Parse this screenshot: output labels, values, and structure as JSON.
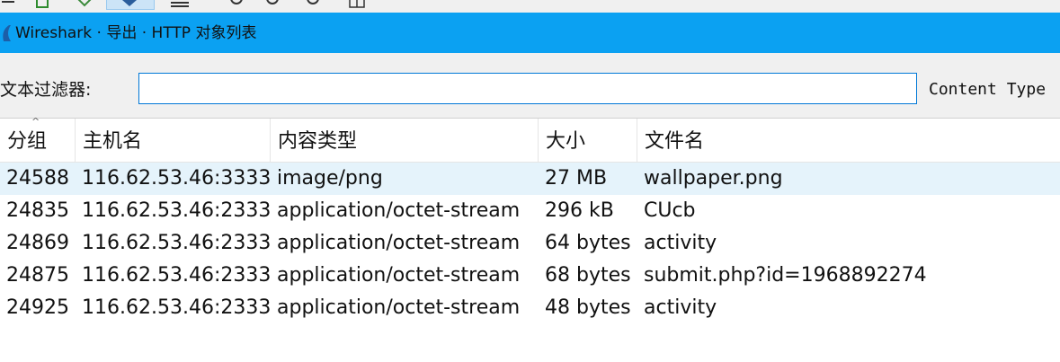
{
  "window": {
    "title": "Wireshark · 导出 · HTTP 对象列表"
  },
  "filter": {
    "label": "文本过滤器:",
    "value": "",
    "content_type_label": "Content Type"
  },
  "table": {
    "columns": [
      "分组",
      "主机名",
      "内容类型",
      "大小",
      "文件名"
    ],
    "rows": [
      {
        "packet": "24588",
        "host": "116.62.53.46:3333",
        "content_type": "image/png",
        "size": "27 MB",
        "filename": "wallpaper.png"
      },
      {
        "packet": "24835",
        "host": "116.62.53.46:2333",
        "content_type": "application/octet-stream",
        "size": "296 kB",
        "filename": "CUcb"
      },
      {
        "packet": "24869",
        "host": "116.62.53.46:2333",
        "content_type": "application/octet-stream",
        "size": "64 bytes",
        "filename": "activity"
      },
      {
        "packet": "24875",
        "host": "116.62.53.46:2333",
        "content_type": "application/octet-stream",
        "size": "68 bytes",
        "filename": "submit.php?id=1968892274"
      },
      {
        "packet": "24925",
        "host": "116.62.53.46:2333",
        "content_type": "application/octet-stream",
        "size": "48 bytes",
        "filename": "activity"
      }
    ],
    "selected_row": 0
  },
  "colors": {
    "titlebar": "#0ba1f2",
    "selected_row": "#e5f3fb",
    "input_border": "#0078d7"
  }
}
